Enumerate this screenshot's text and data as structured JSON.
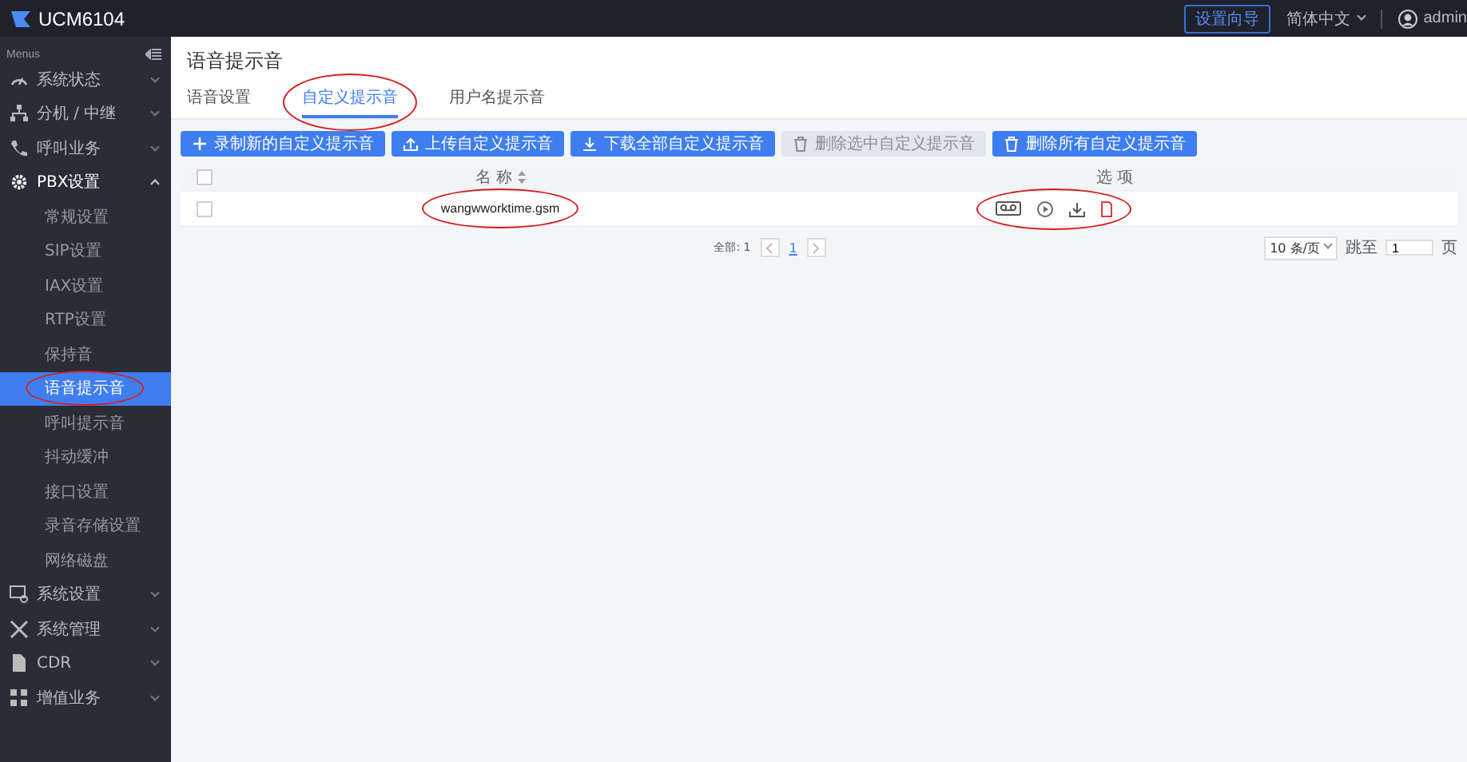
{
  "topbar": {
    "logo": "UCM6104",
    "wizard_button": "设置向导",
    "language": "简体中文",
    "user": "admin"
  },
  "sidebar": {
    "title": "Menus",
    "items": [
      {
        "label": "系统状态",
        "expanded": false
      },
      {
        "label": "分机 / 中继",
        "expanded": false
      },
      {
        "label": "呼叫业务",
        "expanded": false
      },
      {
        "label": "PBX设置",
        "expanded": true,
        "children": [
          {
            "label": "常规设置",
            "selected": false,
            "circled": false
          },
          {
            "label": "SIP设置",
            "selected": false,
            "circled": false
          },
          {
            "label": "IAX设置",
            "selected": false,
            "circled": false
          },
          {
            "label": "RTP设置",
            "selected": false,
            "circled": false
          },
          {
            "label": "保持音",
            "selected": false,
            "circled": false
          },
          {
            "label": "语音提示音",
            "selected": true,
            "circled": true
          },
          {
            "label": "呼叫提示音",
            "selected": false,
            "circled": false
          },
          {
            "label": "抖动缓冲",
            "selected": false,
            "circled": false
          },
          {
            "label": "接口设置",
            "selected": false,
            "circled": false
          },
          {
            "label": "录音存储设置",
            "selected": false,
            "circled": false
          },
          {
            "label": "网络磁盘",
            "selected": false,
            "circled": false
          }
        ]
      },
      {
        "label": "系统设置",
        "expanded": false
      },
      {
        "label": "系统管理",
        "expanded": false
      },
      {
        "label": "CDR",
        "expanded": false
      },
      {
        "label": "增值业务",
        "expanded": false
      }
    ]
  },
  "page_title": "语音提示音",
  "tabs": [
    {
      "label": "语音设置",
      "selected": false,
      "circled": false
    },
    {
      "label": "自定义提示音",
      "selected": true,
      "circled": true
    },
    {
      "label": "用户名提示音",
      "selected": false,
      "circled": false
    }
  ],
  "actions": [
    {
      "label": "录制新的自定义提示音",
      "disabled": false
    },
    {
      "label": "上传自定义提示音",
      "disabled": false
    },
    {
      "label": "下载全部自定义提示音",
      "disabled": false
    },
    {
      "label": "删除选中自定义提示音",
      "disabled": true
    },
    {
      "label": "删除所有自定义提示音",
      "disabled": false
    }
  ],
  "table": {
    "all_checked": false,
    "columns": [
      "名 称",
      "选 项"
    ],
    "rows": [
      {
        "name": "wangwworktime.gsm",
        "checked": false,
        "circled": true
      }
    ]
  },
  "pagination": {
    "total": "全部: 1",
    "pages": [
      {
        "label": "1",
        "selected": true
      }
    ],
    "page_size": "10 条/页",
    "jump_label": "跳至",
    "jump_value": "1",
    "page_unit": "页"
  }
}
